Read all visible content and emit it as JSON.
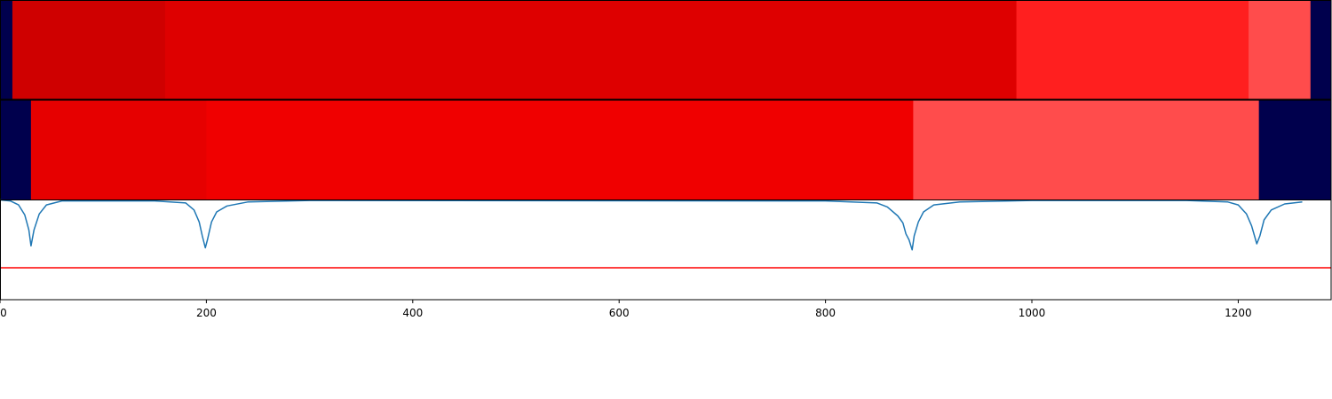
{
  "chart_data": [
    {
      "type": "heatmap",
      "title": "",
      "xlabel": "",
      "ylabel": "",
      "xlim": [
        0,
        1290
      ],
      "colormap": "seismic",
      "segments": [
        {
          "start": 0,
          "end": 12,
          "level": 0.0
        },
        {
          "start": 12,
          "end": 160,
          "level": 0.845
        },
        {
          "start": 160,
          "end": 985,
          "level": 0.815
        },
        {
          "start": 985,
          "end": 1210,
          "level": 0.72
        },
        {
          "start": 1210,
          "end": 1270,
          "level": 0.675
        },
        {
          "start": 1270,
          "end": 1290,
          "level": 0.0
        }
      ]
    },
    {
      "type": "heatmap",
      "title": "",
      "xlabel": "",
      "ylabel": "",
      "xlim": [
        0,
        1290
      ],
      "colormap": "seismic",
      "segments": [
        {
          "start": 0,
          "end": 30,
          "level": 0.0
        },
        {
          "start": 30,
          "end": 200,
          "level": 0.8
        },
        {
          "start": 200,
          "end": 885,
          "level": 0.78
        },
        {
          "start": 885,
          "end": 1220,
          "level": 0.675
        },
        {
          "start": 1220,
          "end": 1290,
          "level": 0.0
        }
      ]
    },
    {
      "type": "line",
      "title": "",
      "xlabel": "",
      "ylabel": "",
      "xlim": [
        0,
        1290
      ],
      "ylim": [
        -1.0,
        0.0
      ],
      "xticks": [
        "0",
        "200",
        "400",
        "600",
        "800",
        "1000",
        "1200"
      ],
      "xtick_values": [
        0,
        200,
        400,
        600,
        800,
        1000,
        1200
      ],
      "grid": false,
      "series": [
        {
          "color": "#1f77b4",
          "x": [
            0,
            10,
            18,
            24,
            28,
            30,
            33,
            38,
            45,
            60,
            150,
            180,
            188,
            193,
            196,
            199,
            201,
            205,
            210,
            220,
            240,
            300,
            800,
            850,
            860,
            870,
            875,
            878,
            881,
            884,
            886,
            890,
            895,
            905,
            930,
            1000,
            1150,
            1190,
            1200,
            1208,
            1213,
            1218,
            1221,
            1225,
            1232,
            1245,
            1262
          ],
          "y": [
            0.0,
            -0.01,
            -0.05,
            -0.15,
            -0.3,
            -0.46,
            -0.3,
            -0.14,
            -0.05,
            -0.01,
            -0.01,
            -0.03,
            -0.1,
            -0.22,
            -0.36,
            -0.48,
            -0.4,
            -0.22,
            -0.12,
            -0.06,
            -0.02,
            -0.005,
            -0.01,
            -0.03,
            -0.07,
            -0.16,
            -0.23,
            -0.34,
            -0.4,
            -0.5,
            -0.36,
            -0.22,
            -0.12,
            -0.05,
            -0.02,
            -0.005,
            -0.005,
            -0.02,
            -0.05,
            -0.14,
            -0.26,
            -0.44,
            -0.36,
            -0.2,
            -0.1,
            -0.04,
            -0.02
          ]
        },
        {
          "color": "#ff0000",
          "x": [
            0,
            1290
          ],
          "y": [
            -0.68,
            -0.68
          ]
        }
      ]
    }
  ]
}
